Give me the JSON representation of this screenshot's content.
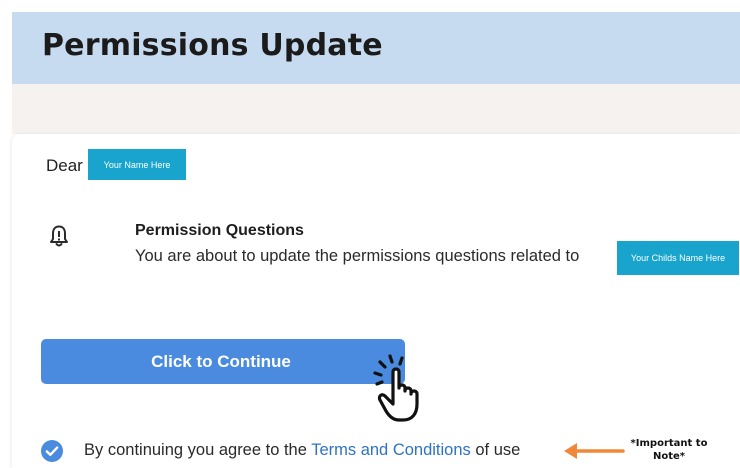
{
  "header": {
    "title": "Permissions Update"
  },
  "greeting": {
    "dear": "Dear",
    "name_chip": "Your Name Here"
  },
  "permission": {
    "title": "Permission Questions",
    "text": "You are about to update the permissions questions related to",
    "child_chip": "Your Childs Name Here",
    "icon": "bell-icon"
  },
  "cta": {
    "label": "Click to Continue"
  },
  "agreement": {
    "prefix": "By continuing you agree to the",
    "link": "Terms and Conditions",
    "suffix": "of use",
    "checked": true
  },
  "annotation": {
    "note": "*Important to Note*"
  },
  "colors": {
    "header_bg": "#c6daf0",
    "chip_bg": "#18a4cc",
    "button_bg": "#4a8bdf",
    "link": "#2f72c4",
    "arrow": "#f0883a"
  }
}
